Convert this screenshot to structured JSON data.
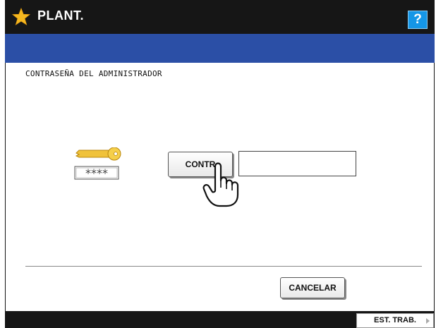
{
  "header": {
    "title": "PLANT.",
    "help_label": "?"
  },
  "panel": {
    "title": "CONTRASEÑA DEL ADMINISTRADOR"
  },
  "password": {
    "button_label": "CONTR",
    "mask": "****"
  },
  "actions": {
    "cancel_label": "CANCELAR"
  },
  "footer": {
    "job_status_label": "EST. TRAB."
  },
  "icons": {
    "title": "star-icon",
    "password": "key-icon",
    "pointer": "hand-pointer-icon",
    "footer": "arrow-right-icon"
  },
  "colors": {
    "titlebar": "#161616",
    "bluebar": "#2b4fa6",
    "help_button": "#1596e6",
    "star": "#f5b820",
    "key": "#f0c23a"
  }
}
